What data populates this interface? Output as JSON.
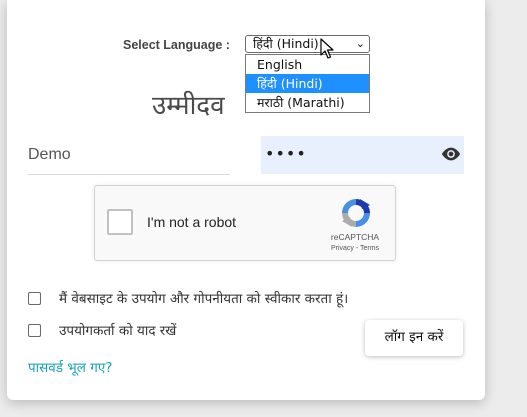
{
  "language": {
    "label": "Select Language :",
    "selected": "हिंदी (Hindi)",
    "options": [
      "English",
      "हिंदी (Hindi)",
      "मराठी (Marathi)"
    ],
    "highlighted_index": 1
  },
  "heading": "उम्मीदव",
  "username": {
    "value": "Demo"
  },
  "password": {
    "masked_value": "••••"
  },
  "recaptcha": {
    "label": "I'm not a robot",
    "brand": "reCAPTCHA",
    "terms": "Privacy - Terms"
  },
  "checkboxes": [
    {
      "label": "मैं वेबसाइट के उपयोग और गोपनीयता को स्वीकार करता हूं।",
      "checked": false
    },
    {
      "label": "उपयोगकर्ता को याद रखें",
      "checked": false
    }
  ],
  "login_button": "लॉग इन करें",
  "forgot_link": "पासवर्ड भूल गए?",
  "colors": {
    "link": "#17a2b8",
    "highlight": "#1e90ff",
    "password_bg": "#e8f0fe"
  }
}
